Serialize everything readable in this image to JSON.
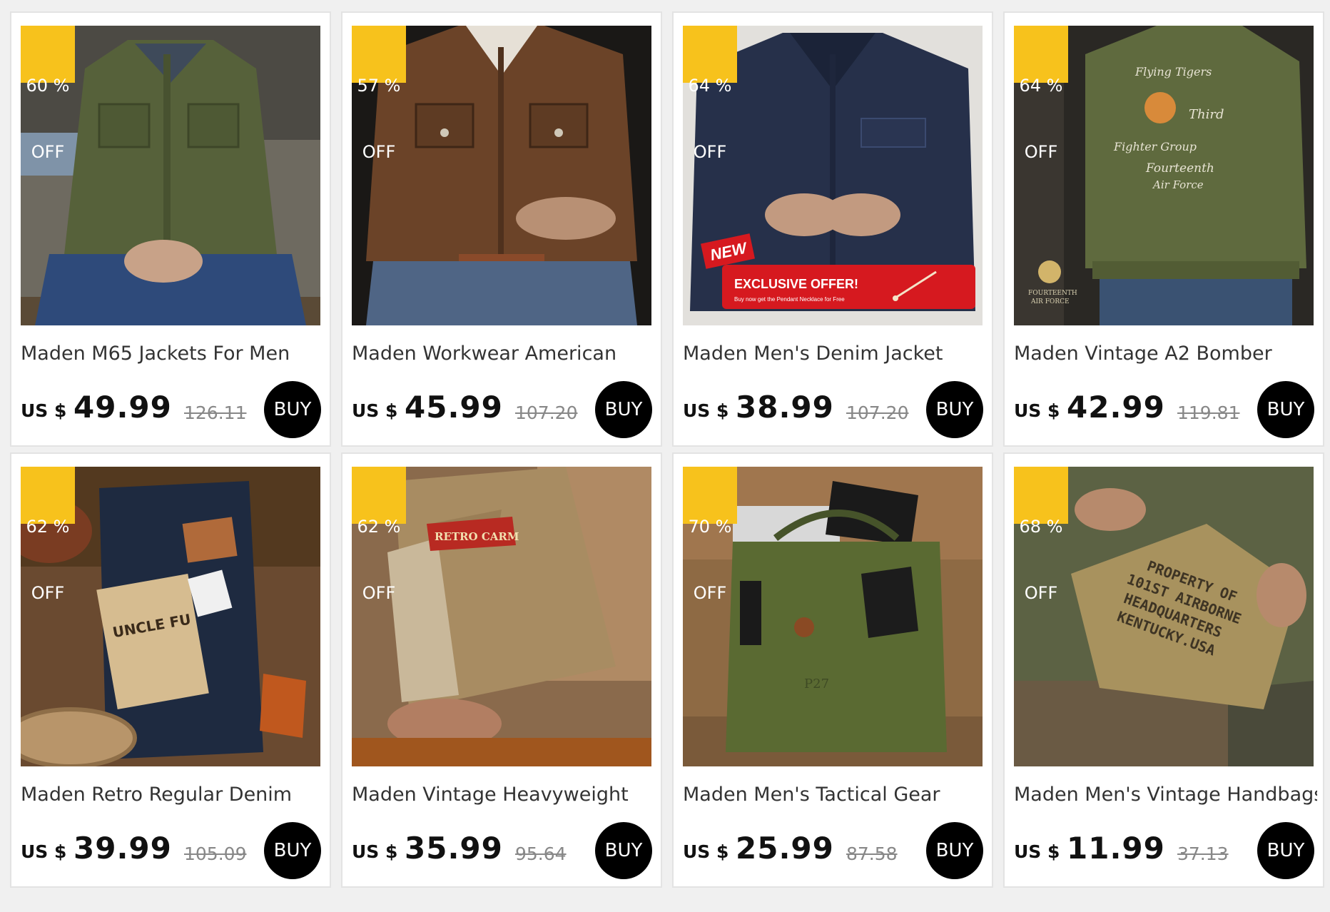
{
  "currency_label": "US $",
  "buy_label": "BUY",
  "off_label": "OFF",
  "products": [
    {
      "discount": "60 %",
      "title": "Maden M65 Jackets For Men",
      "price": "49.99",
      "old_price": "126.11",
      "image": "olive-m65-jacket-photo"
    },
    {
      "discount": "57 %",
      "title": "Maden Workwear American",
      "price": "45.99",
      "old_price": "107.20",
      "image": "brown-waxed-jacket-photo"
    },
    {
      "discount": "64 %",
      "title": "Maden Men's Denim Jacket",
      "price": "38.99",
      "old_price": "107.20",
      "image": "denim-jacket-photo",
      "promo": {
        "new": "NEW",
        "headline": "EXCLUSIVE OFFER!",
        "sub": "Buy now get the Pendant Necklace for Free"
      }
    },
    {
      "discount": "64 %",
      "title": "Maden Vintage A2 Bomber",
      "price": "42.99",
      "old_price": "119.81",
      "image": "green-bomber-back-photo",
      "embroidery": [
        "Flying Tigers",
        "Third",
        "Fighter Group",
        "Fourteenth",
        "Air Force"
      ],
      "logo_text": [
        "FOURTEENTH",
        "AIR FORCE"
      ]
    },
    {
      "discount": "62 %",
      "title": "Maden Retro Regular Denim",
      "price": "39.99",
      "old_price": "105.09",
      "image": "raw-denim-jeans-photo",
      "tag_text": "UNCLE FU"
    },
    {
      "discount": "62 %",
      "title": "Maden Vintage Heavyweight",
      "price": "35.99",
      "old_price": "95.64",
      "image": "khaki-chinos-photo",
      "patch_text": "RETRO CARM"
    },
    {
      "discount": "70 %",
      "title": "Maden Men's Tactical Gear",
      "price": "25.99",
      "old_price": "87.58",
      "image": "olive-helmet-bag-photo",
      "stencil": "P27"
    },
    {
      "discount": "68 %",
      "title": "Maden Men's Vintage Handbags",
      "price": "11.99",
      "old_price": "37.13",
      "image": "canvas-pouch-photo",
      "stencil_lines": [
        "PROPERTY OF",
        "101ST AIRBORNE",
        "HEADQUARTERS",
        "KENTUCKY.USA"
      ]
    }
  ],
  "colors": {
    "badge": "#f7c21c",
    "buy_button": "#000000",
    "promo_red": "#d6191f"
  }
}
